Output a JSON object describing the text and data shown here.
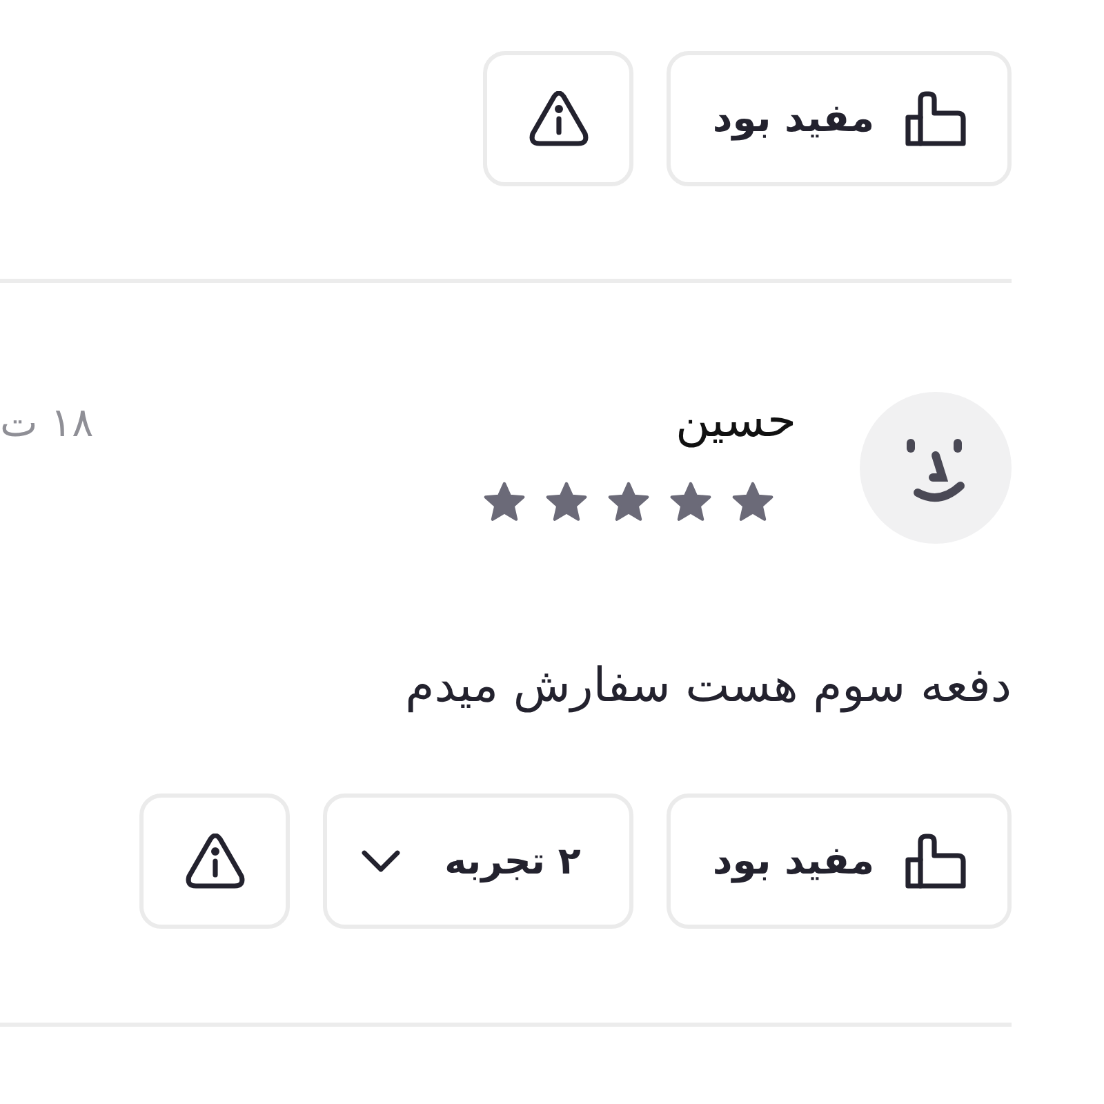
{
  "top_actions": {
    "buttons": [
      {
        "kind": "helpful",
        "label": "مفید بود"
      },
      {
        "kind": "report"
      }
    ]
  },
  "review": {
    "author": "حسین",
    "date": "۱۸ ت",
    "stars": 5,
    "comment": "دفعه سوم هست سفارش میدم",
    "buttons": [
      {
        "kind": "helpful",
        "label": "مفید بود"
      },
      {
        "kind": "experiences",
        "label": "۲ تجربه"
      },
      {
        "kind": "report"
      }
    ]
  }
}
